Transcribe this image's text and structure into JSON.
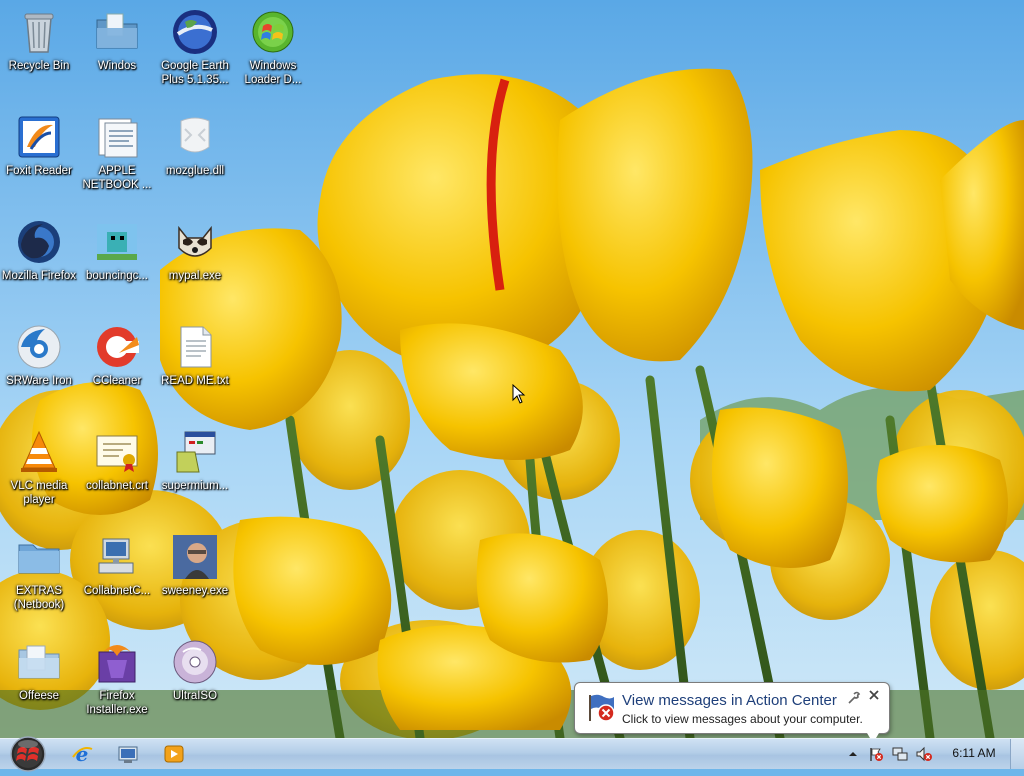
{
  "desktop": {
    "icons": [
      {
        "label": "Recycle Bin",
        "icon": "recycle-bin-icon"
      },
      {
        "label": "Windos",
        "icon": "folder-icon"
      },
      {
        "label": "Google Earth Plus 5.1.35...",
        "icon": "google-earth-icon"
      },
      {
        "label": "Windows Loader D...",
        "icon": "windows-loader-icon"
      },
      {
        "label": "Foxit Reader",
        "icon": "foxit-reader-icon"
      },
      {
        "label": "APPLE NETBOOK ...",
        "icon": "document-icon"
      },
      {
        "label": "mozglue.dll",
        "icon": "dll-file-icon"
      },
      {
        "label": "Mozilla Firefox",
        "icon": "firefox-icon"
      },
      {
        "label": "bouncingc...",
        "icon": "game-icon"
      },
      {
        "label": "mypal.exe",
        "icon": "mypal-icon"
      },
      {
        "label": "SRWare Iron",
        "icon": "srware-iron-icon"
      },
      {
        "label": "CCleaner",
        "icon": "ccleaner-icon"
      },
      {
        "label": "READ ME.txt",
        "icon": "text-file-icon"
      },
      {
        "label": "VLC media player",
        "icon": "vlc-icon"
      },
      {
        "label": "collabnet.crt",
        "icon": "certificate-icon"
      },
      {
        "label": "supermium...",
        "icon": "installer-icon"
      },
      {
        "label": "EXTRAS (Netbook)",
        "icon": "folder-icon"
      },
      {
        "label": "CollabnetC...",
        "icon": "computer-icon"
      },
      {
        "label": "sweeney.exe",
        "icon": "photo-icon"
      },
      {
        "label": "Offeese",
        "icon": "folder-icon"
      },
      {
        "label": "Firefox Installer.exe",
        "icon": "firefox-installer-icon"
      },
      {
        "label": "UltraISO",
        "icon": "disc-icon"
      }
    ]
  },
  "balloon": {
    "title": "View messages in Action Center",
    "body": "Click to view messages about your computer.",
    "icon": "action-center-flag-icon"
  },
  "taskbar": {
    "start_icon": "start-orb-icon",
    "pinned": [
      "internet-explorer-icon",
      "windows-explorer-icon",
      "media-player-icon"
    ],
    "tray": [
      "show-hidden-icons-chevron",
      "action-center-flag-icon",
      "network-icon",
      "volume-muted-icon"
    ],
    "clock": "6:11 AM"
  },
  "colors": {
    "sky": "#6fb6ea",
    "tulip": "#f5c400",
    "taskbar": "#b4cee8",
    "balloon_title": "#1e3f7a"
  }
}
